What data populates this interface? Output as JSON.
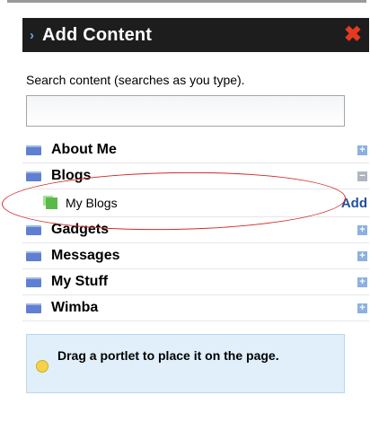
{
  "panel": {
    "title": "Add Content",
    "close_icon": "close-x-icon"
  },
  "search": {
    "label": "Search content (searches as you type).",
    "value": "",
    "placeholder": ""
  },
  "categories": [
    {
      "label": "About Me",
      "state": "collapsed",
      "toggle": "+"
    },
    {
      "label": "Blogs",
      "state": "expanded",
      "toggle": "−",
      "items": [
        {
          "label": "My Blogs",
          "action": "Add"
        }
      ]
    },
    {
      "label": "Gadgets",
      "state": "collapsed",
      "toggle": "+"
    },
    {
      "label": "Messages",
      "state": "collapsed",
      "toggle": "+"
    },
    {
      "label": "My Stuff",
      "state": "collapsed",
      "toggle": "+"
    },
    {
      "label": "Wimba",
      "state": "collapsed",
      "toggle": "+"
    }
  ],
  "hint": {
    "text": "Drag a portlet to place it on the page."
  },
  "colors": {
    "header_bg": "#1d1d1d",
    "close": "#e53a1f",
    "link": "#1f4fa0",
    "annotation": "#d42a2a",
    "hint_bg": "#e0effa"
  }
}
